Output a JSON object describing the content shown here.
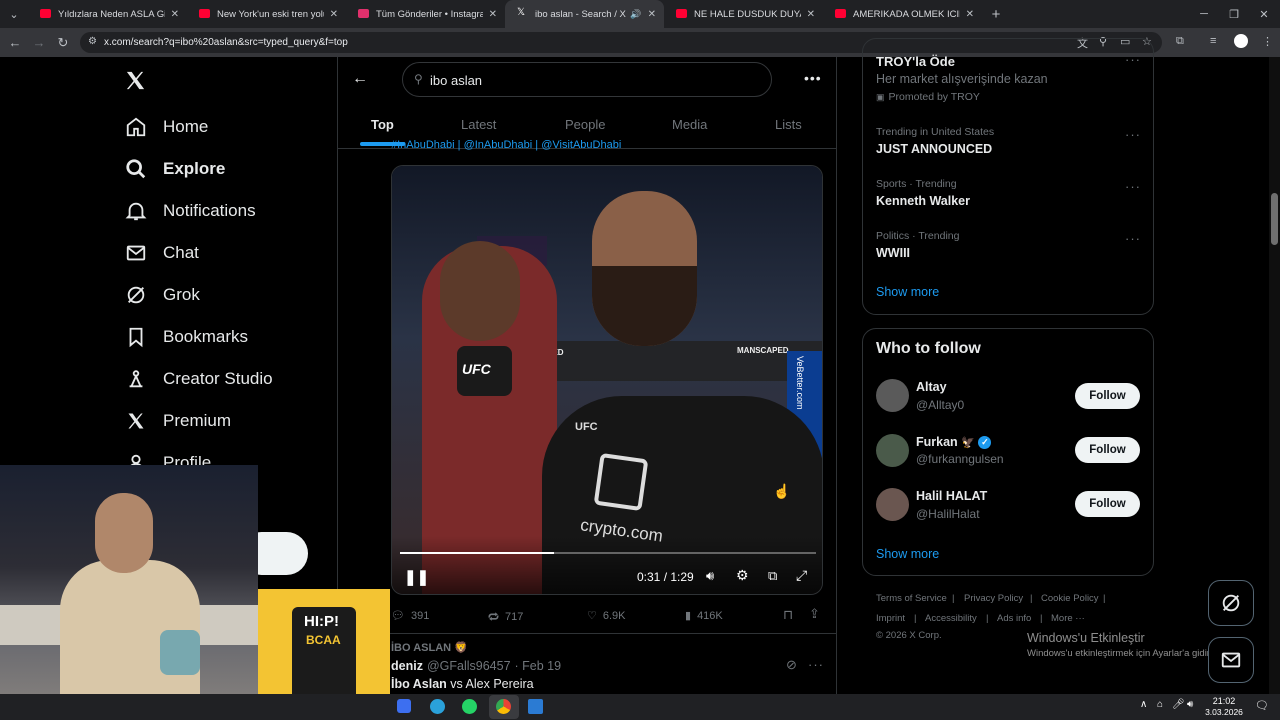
{
  "browser": {
    "tabs": [
      {
        "title": "Yıldızlara Neden ASLA Gidemey",
        "favicon_color": "#ff0033"
      },
      {
        "title": "New York'un eski tren yolunda",
        "favicon_color": "#ff0033"
      },
      {
        "title": "Tüm Gönderiler • Instagram",
        "favicon_color": "#e1306c"
      },
      {
        "title": "ibo aslan - Search / X",
        "favicon_color": "#ffffff"
      },
      {
        "title": "NE HALE DUSDUK DUYAN YOK",
        "favicon_color": "#ff0033"
      },
      {
        "title": "AMERIKADA OLMEK ICIN KENDI",
        "favicon_color": "#ff0033"
      }
    ],
    "active_tab": 3,
    "url": "x.com/search?q=ibo%20aslan&src=typed_query&f=top",
    "new_tab": "+"
  },
  "sidebar": {
    "items": [
      {
        "label": "Home",
        "icon": "home-icon"
      },
      {
        "label": "Explore",
        "icon": "search-icon"
      },
      {
        "label": "Notifications",
        "icon": "bell-icon"
      },
      {
        "label": "Chat",
        "icon": "mail-icon"
      },
      {
        "label": "Grok",
        "icon": "grok-icon"
      },
      {
        "label": "Bookmarks",
        "icon": "bookmark-icon"
      },
      {
        "label": "Creator Studio",
        "icon": "creator-icon"
      },
      {
        "label": "Premium",
        "icon": "x-logo-icon"
      },
      {
        "label": "Profile",
        "icon": "person-icon"
      }
    ]
  },
  "search": {
    "query": "ibo aslan",
    "tabs": [
      "Top",
      "Latest",
      "People",
      "Media",
      "Lists"
    ],
    "active_tab": "Top"
  },
  "post": {
    "cutoff_text": "#InAbuDhabi | @InAbuDhabi | @VisitAbuDhabi",
    "video": {
      "time": "0:31 / 1:29",
      "progress": 0.37,
      "ufc_text": "UFC",
      "shirt_text": "crypto.com",
      "banner_text": "MANSCAPED",
      "side_text": "VeBetter.com"
    },
    "metrics": {
      "replies": "391",
      "reposts": "717",
      "likes": "6.9K",
      "views": "416K"
    }
  },
  "next_post": {
    "context": "İBO ASLAN 🦁",
    "name": "deniz",
    "handle": "@GFalls96457",
    "date": "· Feb 19",
    "text_bold": "İbo Aslan",
    "text_rest": " vs Alex Pereira"
  },
  "right": {
    "ad": {
      "title": "TROY'la Öde",
      "desc": "Her market alışverişinde kazan",
      "promoted": "Promoted by TROY"
    },
    "trends": [
      {
        "meta": "Trending in United States",
        "name": "JUST ANNOUNCED"
      },
      {
        "meta": "Sports · Trending",
        "name": "Kenneth Walker"
      },
      {
        "meta": "Politics · Trending",
        "name": "WWIII"
      }
    ],
    "show_more": "Show more",
    "who_to_follow": {
      "title": "Who to follow",
      "users": [
        {
          "name": "Altay",
          "handle": "@Alltay0",
          "follow": "Follow",
          "verified": false,
          "emoji": ""
        },
        {
          "name": "Furkan",
          "handle": "@furkanngulsen",
          "follow": "Follow",
          "verified": true,
          "emoji": "🦅"
        },
        {
          "name": "Halil HALAT",
          "handle": "@HalilHalat",
          "follow": "Follow",
          "verified": false,
          "emoji": ""
        }
      ],
      "show_more": "Show more"
    },
    "footer": {
      "links": [
        "Terms of Service",
        "Privacy Policy",
        "Cookie Policy",
        "Imprint",
        "Accessibility",
        "Ads info",
        "More ···"
      ],
      "copyright": "© 2026 X Corp."
    }
  },
  "overlay": {
    "activate_title": "Windows'u Etkinleştir",
    "activate_sub": "Windows'u etkinleştirmek için Ayarlar'a gidin."
  },
  "ad_product": {
    "brand": "HI:P!",
    "product": "BCAA"
  },
  "taskbar": {
    "time": "21:02",
    "date": "3.03.2026"
  },
  "colors": {
    "accent": "#1d9bf0",
    "background": "#000000",
    "border": "#2f3336",
    "muted": "#71767b"
  }
}
